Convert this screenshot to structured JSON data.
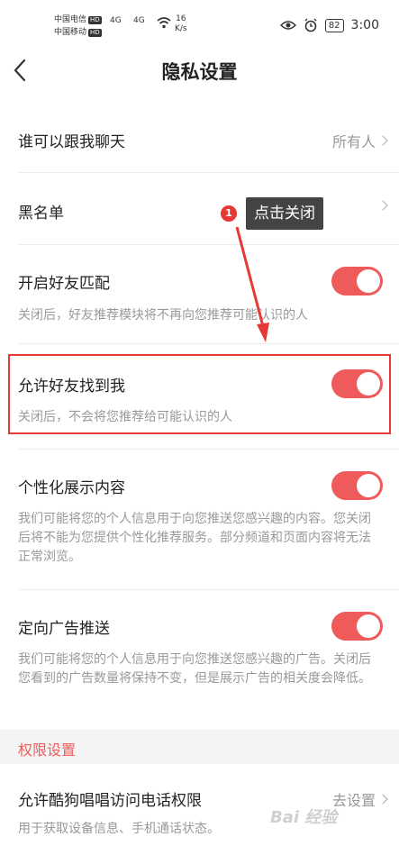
{
  "status_bar": {
    "carrier1": "中国电信",
    "carrier2": "中国移动",
    "hd": "HD",
    "signal1": "4G",
    "signal2": "4G",
    "speed_value": "16",
    "speed_unit": "K/s",
    "battery": "82",
    "time": "3:00"
  },
  "header": {
    "title": "隐私设置"
  },
  "rows": [
    {
      "title": "谁可以跟我聊天",
      "value": "所有人"
    },
    {
      "title": "黑名单"
    },
    {
      "title": "开启好友匹配",
      "desc": "关闭后，好友推荐模块将不再向您推荐可能认识的人",
      "toggle_on": true
    },
    {
      "title": "允许好友找到我",
      "desc": "关闭后，不会将您推荐给可能认识的人",
      "toggle_on": true
    },
    {
      "title": "个性化展示内容",
      "desc": "我们可能将您的个人信息用于向您推送您感兴趣的内容。您关闭后将不能为您提供个性化推荐服务。部分频道和页面内容将无法正常浏览。",
      "toggle_on": true
    },
    {
      "title": "定向广告推送",
      "desc": "我们可能将您的个人信息用于向您推送您感兴趣的广告。关闭后您看到的广告数量将保持不变，但是展示广告的相关度会降低。",
      "toggle_on": true
    }
  ],
  "section": {
    "title": "权限设置"
  },
  "permission": {
    "title": "允许酷狗唱唱访问电话权限",
    "value": "去设置",
    "desc": "用于获取设备信息、手机通话状态。"
  },
  "annotation": {
    "badge": "1",
    "text": "点击关闭"
  },
  "watermark": "Bai 经验",
  "colors": {
    "accent": "#ef5a5a",
    "highlight": "#e53935"
  },
  "icons": [
    "back-arrow-icon",
    "eye-icon",
    "alarm-icon",
    "wifi-icon",
    "chevron-right-icon"
  ]
}
